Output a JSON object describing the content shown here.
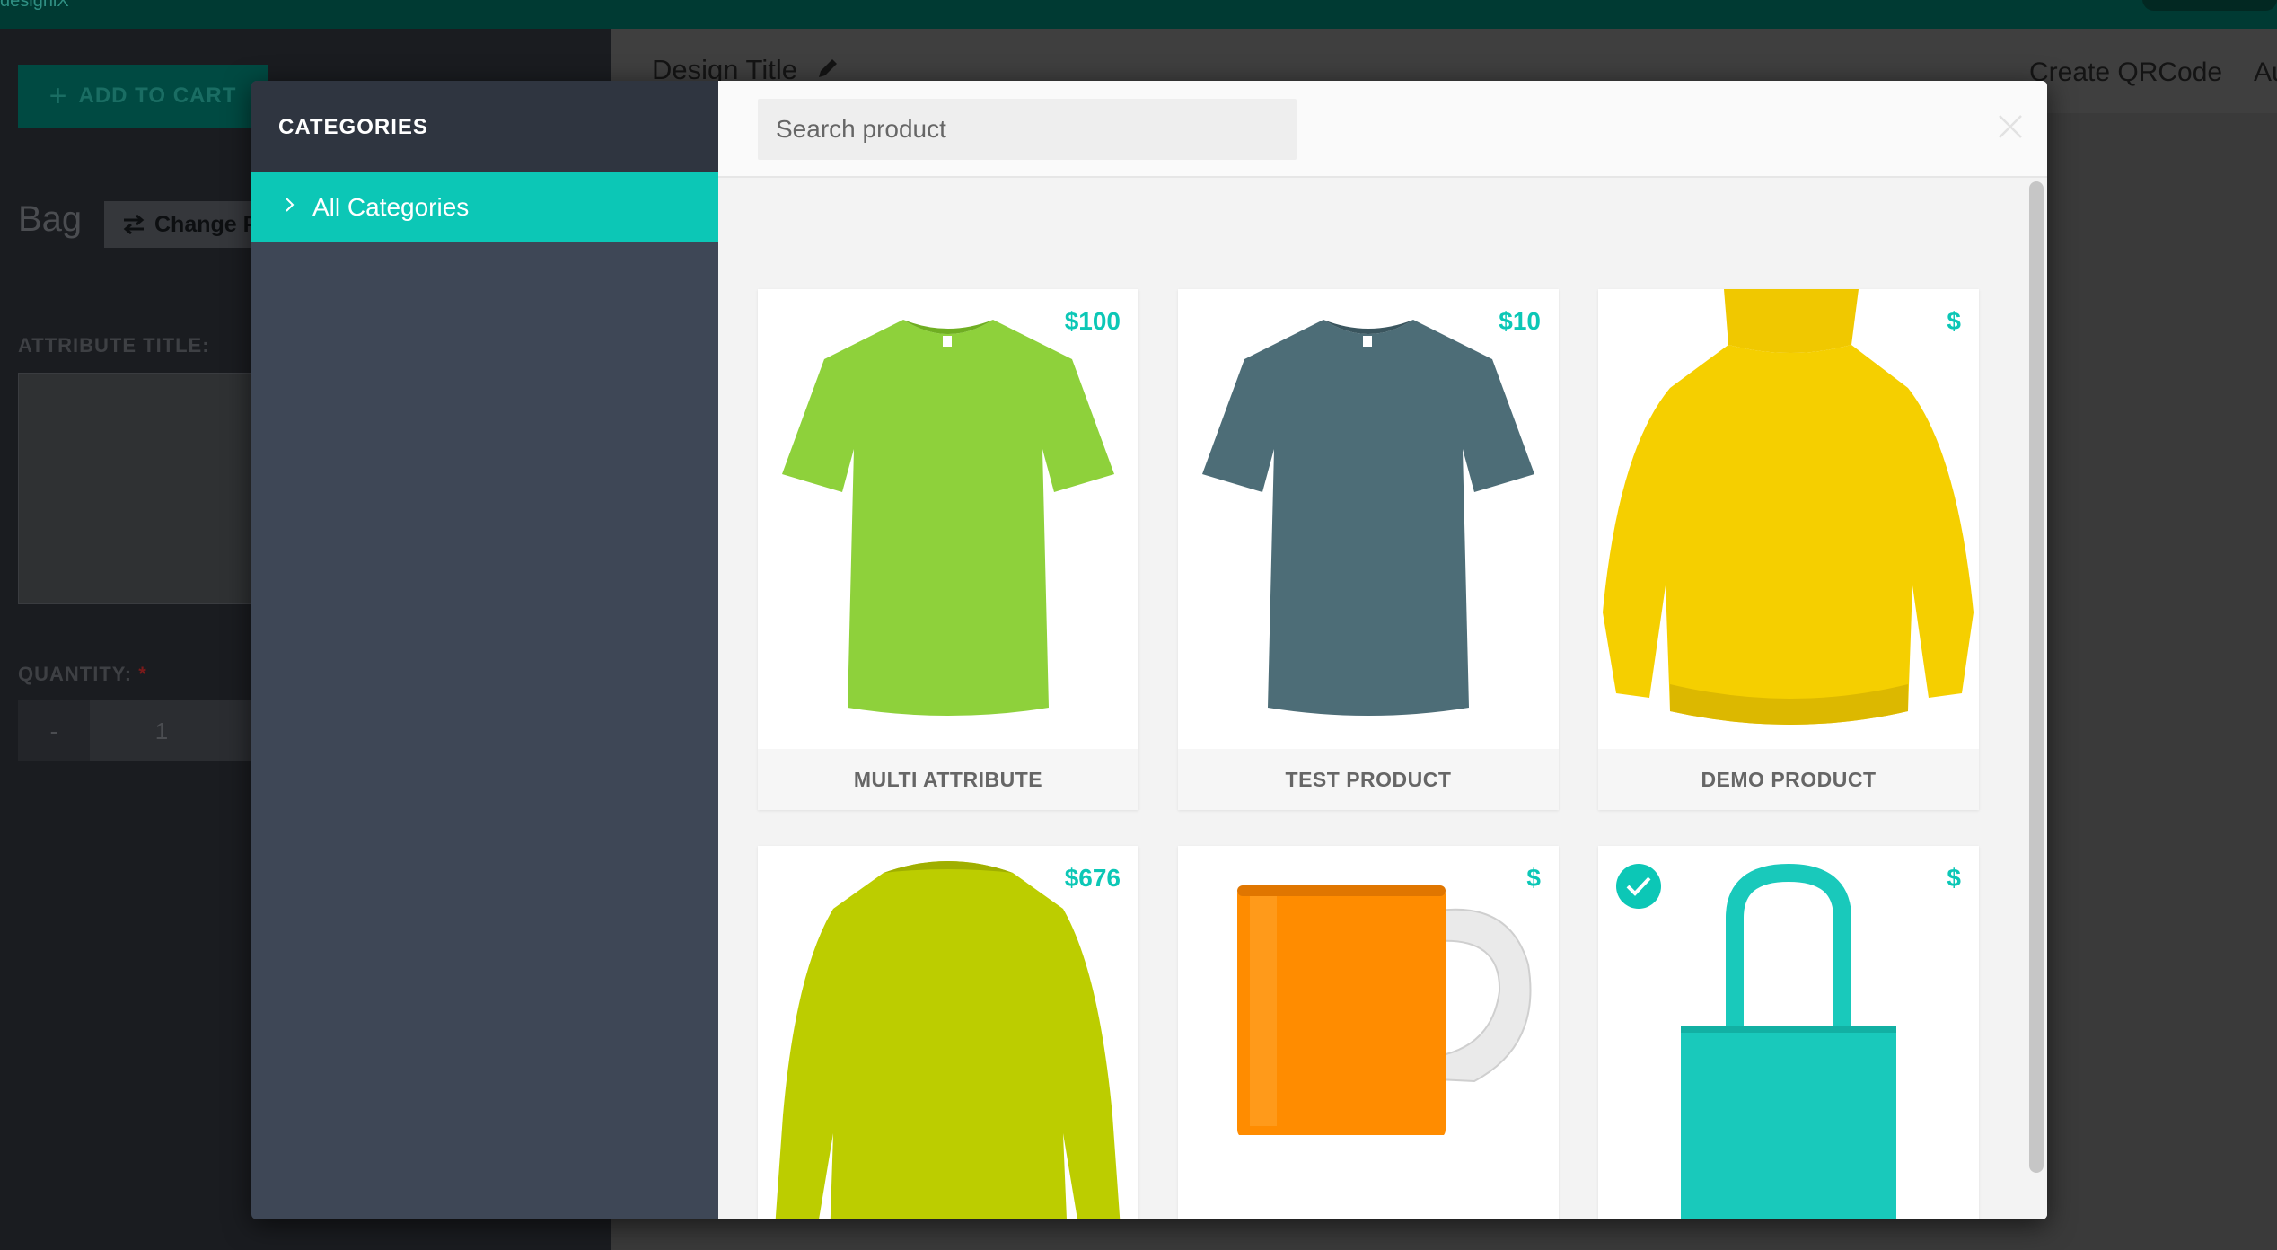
{
  "background": {
    "topbar_logo": "designiX",
    "add_to_cart_label": "ADD TO CART",
    "product_label": "Bag",
    "change_button_label": "Change P",
    "attribute_title_label": "ATTRIBUTE TITLE:",
    "quantity_label": "QUANTITY:",
    "quantity_required_mark": "*",
    "quantity_minus_label": "-",
    "quantity_value": "1",
    "design_title": "Design Title",
    "create_qrcode_label": "Create QRCode",
    "header_cut_label": "Au"
  },
  "modal": {
    "sidebar": {
      "title": "CATEGORIES",
      "categories": [
        {
          "label": "All Categories",
          "active": true
        }
      ]
    },
    "search": {
      "placeholder": "Search product",
      "value": ""
    },
    "products": [
      {
        "name": "MULTI ATTRIBUTE",
        "price": "$100",
        "icon": "green-tshirt-image",
        "color": "#8ed13b",
        "selected": false
      },
      {
        "name": "TEST PRODUCT",
        "price": "$10",
        "icon": "slate-tshirt-image",
        "color": "#4d6d77",
        "selected": false
      },
      {
        "name": "DEMO PRODUCT",
        "price": "$",
        "icon": "yellow-hoodie-image",
        "color": "#f5cf00",
        "selected": false
      },
      {
        "name": "",
        "price": "$676",
        "icon": "lime-longsleeve-image",
        "color": "#bccd00",
        "selected": false
      },
      {
        "name": "",
        "price": "$",
        "icon": "orange-mug-image",
        "color": "#ff8c00",
        "selected": false
      },
      {
        "name": "",
        "price": "$",
        "icon": "teal-tote-bag-image",
        "color": "#19c9bb",
        "selected": true
      }
    ]
  },
  "colors": {
    "accent": "#0cc7b6",
    "sidebar_bg": "#3e4756",
    "sidebar_header_bg": "#2f3540",
    "content_bg": "#f3f3f3",
    "topbar_bg": "#003a33"
  }
}
